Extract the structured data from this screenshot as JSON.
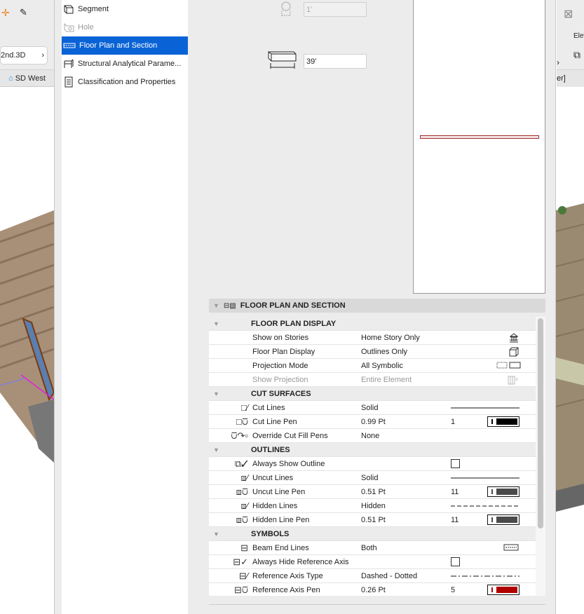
{
  "background": {
    "left_breadcrumb": "2nd.3D",
    "left_tab": "SD West",
    "right_label": "Elev",
    "right_tab": "er]"
  },
  "sidebar": {
    "items": [
      {
        "label": "Segment",
        "icon": "segment-icon",
        "state": "normal"
      },
      {
        "label": "Hole",
        "icon": "hole-icon",
        "state": "disabled"
      },
      {
        "label": "Floor Plan and Section",
        "icon": "floor-plan-icon",
        "state": "selected"
      },
      {
        "label": "Structural Analytical Parame...",
        "icon": "structural-icon",
        "state": "normal"
      },
      {
        "label": "Classification and Properties",
        "icon": "document-icon",
        "state": "normal"
      }
    ]
  },
  "fields": {
    "profile_height": "1'",
    "length": "39'"
  },
  "section": {
    "title": "FLOOR PLAN AND SECTION",
    "groups": [
      {
        "label": "FLOOR PLAN DISPLAY",
        "rows": [
          {
            "name": "Show on Stories",
            "value": "Home Story Only",
            "extra": "stories-icon"
          },
          {
            "name": "Floor Plan Display",
            "value": "Outlines Only",
            "extra": "box-icon"
          },
          {
            "name": "Projection Mode",
            "value": "All Symbolic",
            "extra": "projection-icon"
          },
          {
            "name": "Show Projection",
            "value": "Entire Element",
            "extra": "show-projection-icon",
            "disabled": true
          }
        ]
      },
      {
        "label": "CUT SURFACES",
        "rows": [
          {
            "name": "Cut Lines",
            "value": "Solid",
            "icon": "cut-line-icon",
            "line": "solid"
          },
          {
            "name": "Cut Line Pen",
            "value": "0.99 Pt",
            "icon": "cut-pen-icon",
            "pen": "1",
            "color": "#000000"
          },
          {
            "name": "Override Cut Fill Pens",
            "value": "None",
            "icon": "override-fill-icon"
          }
        ]
      },
      {
        "label": "OUTLINES",
        "rows": [
          {
            "name": "Always Show Outline",
            "icon": "outline-check-icon",
            "checkbox": false
          },
          {
            "name": "Uncut Lines",
            "value": "Solid",
            "icon": "uncut-line-icon",
            "line": "solid"
          },
          {
            "name": "Uncut Line Pen",
            "value": "0.51 Pt",
            "icon": "uncut-pen-icon",
            "pen": "11",
            "color": "#4a4a4a"
          },
          {
            "name": "Hidden Lines",
            "value": "Hidden",
            "icon": "hidden-line-icon",
            "line": "dashed"
          },
          {
            "name": "Hidden Line Pen",
            "value": "0.51 Pt",
            "icon": "hidden-pen-icon",
            "pen": "11",
            "color": "#4a4a4a"
          }
        ]
      },
      {
        "label": "SYMBOLS",
        "rows": [
          {
            "name": "Beam End Lines",
            "value": "Both",
            "icon": "beam-end-icon",
            "extra": "beam-end-preview-icon"
          },
          {
            "name": "Always Hide Reference Axis",
            "icon": "axis-check-icon",
            "checkbox": false
          },
          {
            "name": "Reference Axis Type",
            "value": "Dashed - Dotted",
            "icon": "axis-type-icon",
            "line": "dashdot"
          },
          {
            "name": "Reference Axis Pen",
            "value": "0.26 Pt",
            "icon": "axis-pen-icon",
            "pen": "5",
            "color": "#b00000"
          }
        ]
      }
    ]
  }
}
